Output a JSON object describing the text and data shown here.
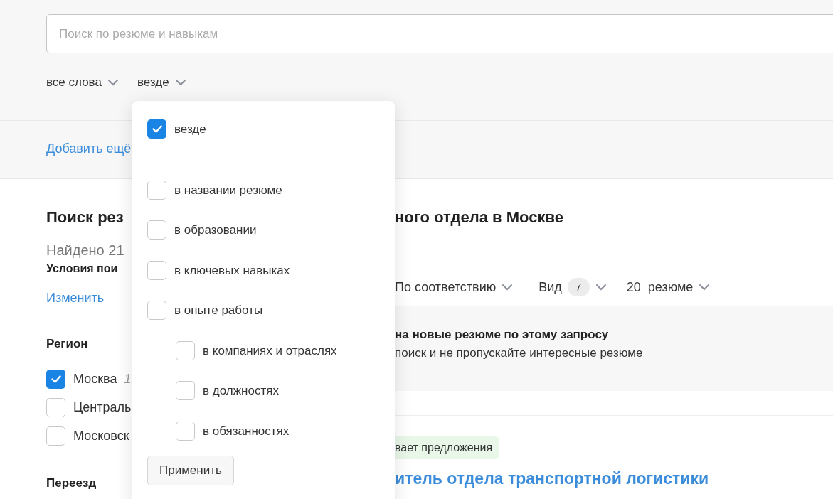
{
  "search": {
    "placeholder": "Поиск по резюме и навыкам"
  },
  "filters": [
    {
      "label": "все слова"
    },
    {
      "label": "везде"
    }
  ],
  "add_more_link": "Добавить ещё",
  "title_left": "Поиск рез",
  "title_right": "ного отдела в Москве",
  "left": {
    "found": "Найдено 21",
    "conditions": "Условия пои",
    "change_link": "Изменить",
    "region": {
      "title": "Регион",
      "options": [
        {
          "label": "Москва",
          "count": "1",
          "checked": true
        },
        {
          "label": "Централь",
          "checked": false
        },
        {
          "label": "Московск",
          "checked": false
        }
      ]
    },
    "relocation": {
      "title": "Переезд"
    }
  },
  "sort": {
    "order": "По соответствию",
    "view": "Вид",
    "view_count": "7",
    "per_page": "20",
    "per_page_unit": "резюме"
  },
  "subscribe": {
    "title": "на новые резюме по этому запросу",
    "text": "поиск и не пропускайте интересные резюме"
  },
  "resume": {
    "status": "вает предложения",
    "title": "итель отдела транспортной логистики"
  },
  "dropdown": {
    "all": {
      "label": "везде",
      "checked": true
    },
    "options": [
      {
        "label": "в названии резюме",
        "checked": false
      },
      {
        "label": "в образовании",
        "checked": false
      },
      {
        "label": "в ключевых навыках",
        "checked": false
      },
      {
        "label": "в опыте работы",
        "checked": false,
        "children": [
          {
            "label": "в компаниях и отраслях",
            "checked": false
          },
          {
            "label": "в должностях",
            "checked": false
          },
          {
            "label": "в обязанностях",
            "checked": false
          }
        ]
      }
    ],
    "apply": "Применить"
  }
}
